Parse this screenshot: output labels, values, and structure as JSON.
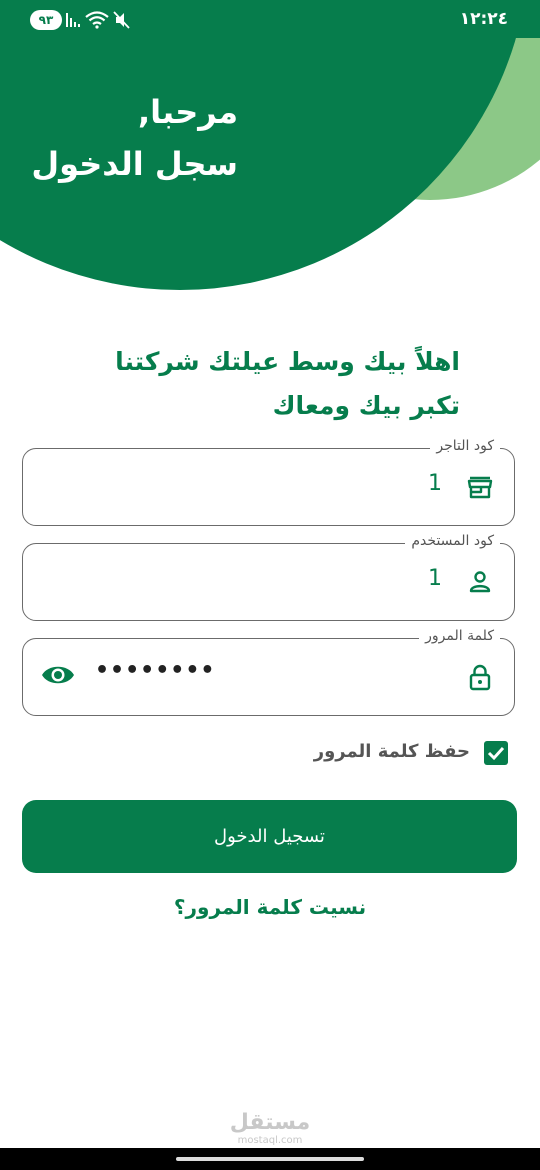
{
  "status_bar": {
    "time": "١٢:٢٤",
    "battery": "٩٣",
    "icons": [
      "signal-icon",
      "wifi-icon",
      "mute-icon"
    ]
  },
  "hero": {
    "title": "مرحبا,\nسجل الدخول"
  },
  "welcome_text": "اهلاً بيك وسط عيلتك شركتنا تكبر بيك ومعاك",
  "form": {
    "merchant_code": {
      "label": "كود التاجر",
      "value": "1",
      "icon": "store-icon"
    },
    "user_code": {
      "label": "كود المستخدم",
      "value": "1",
      "icon": "person-icon"
    },
    "password": {
      "label": "كلمة المرور",
      "value": "••••••••",
      "icon": "lock-icon",
      "toggle_icon": "eye-icon"
    },
    "remember": {
      "label": "حفظ كلمة المرور",
      "checked": true
    }
  },
  "login_button": "تسجيل الدخول",
  "forgot_link": "نسيت كلمة المرور؟",
  "watermark": {
    "main": "مستقل",
    "sub": "mostaql.com"
  },
  "colors": {
    "primary": "#067d4c",
    "light_green": "#8cc887",
    "text_gray": "#555555"
  }
}
